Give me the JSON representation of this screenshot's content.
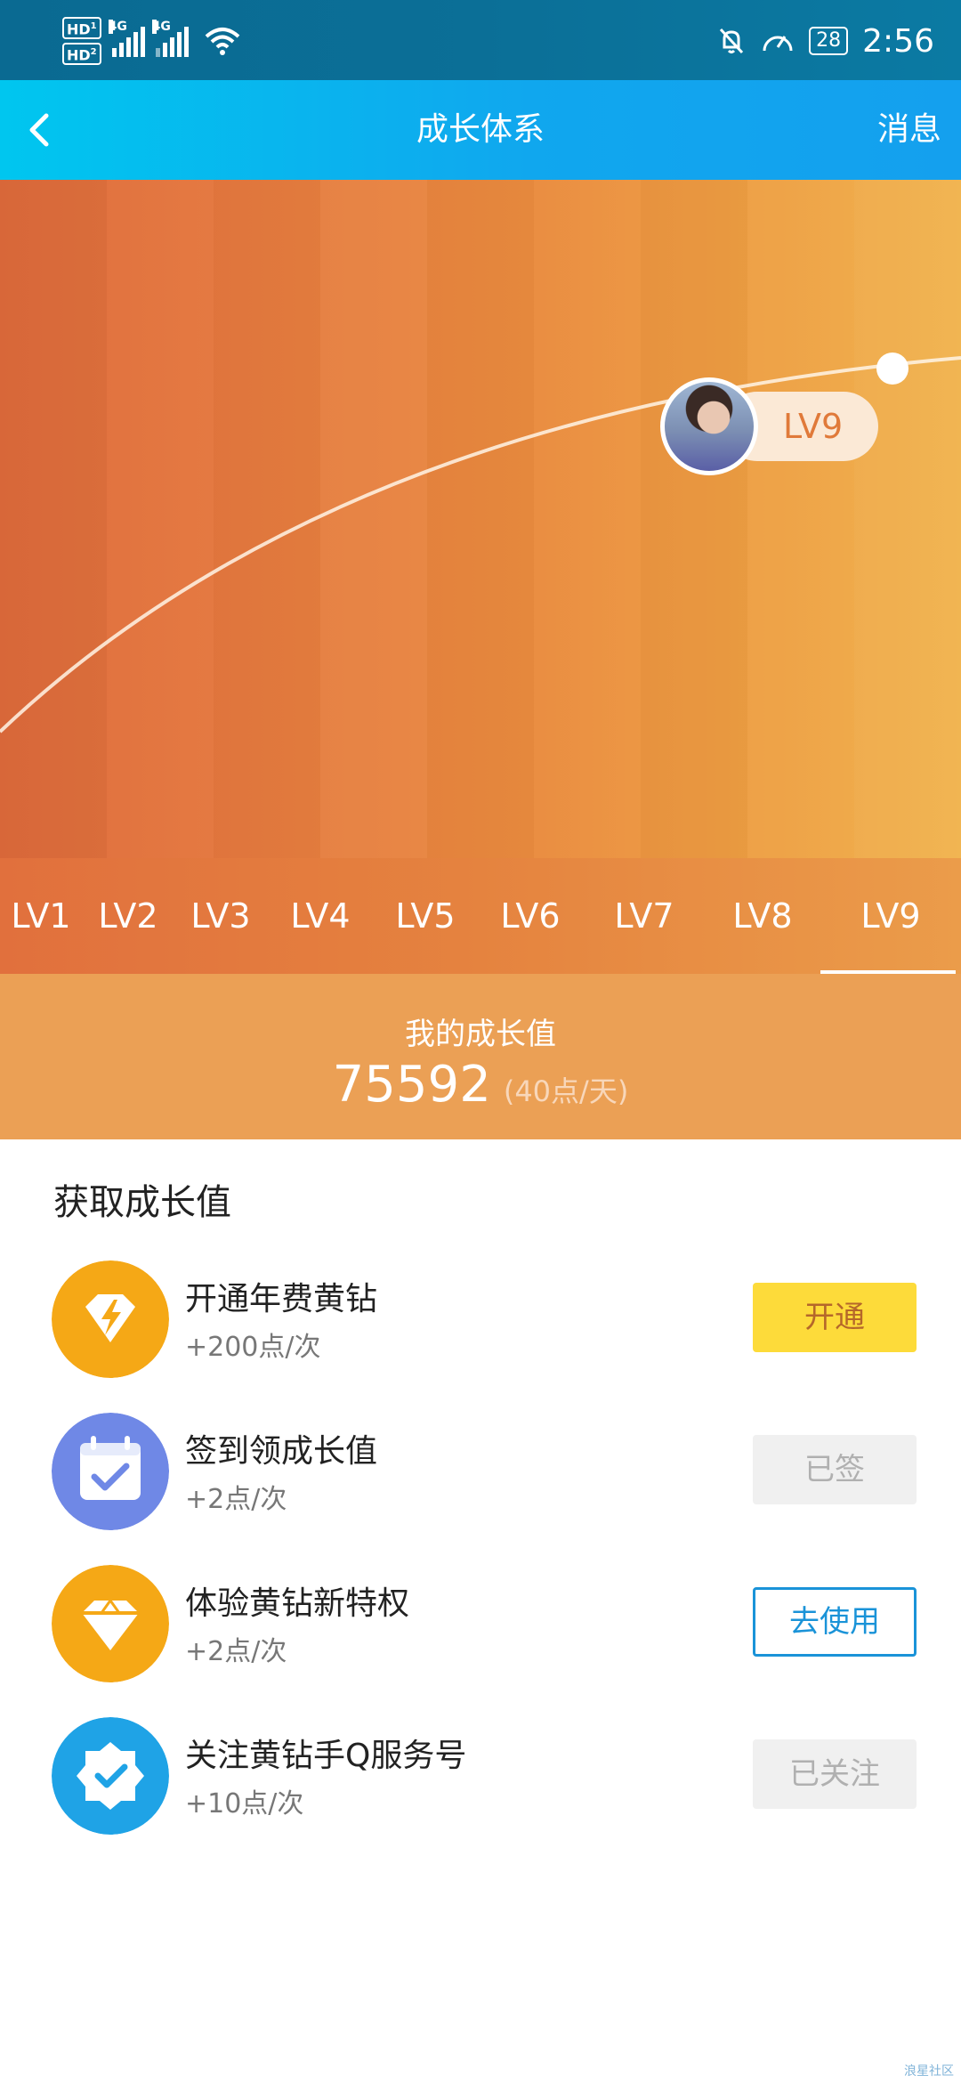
{
  "status_bar": {
    "hd1": "HD",
    "hd1_sub": "1",
    "hd2": "HD",
    "hd2_sub": "2",
    "net1": "4G",
    "net2": "4G",
    "battery": "28",
    "time": "2:56"
  },
  "header": {
    "title": "成长体系",
    "message": "消息"
  },
  "hero": {
    "current_level": "LV9"
  },
  "levels": [
    "LV1",
    "LV2",
    "LV3",
    "LV4",
    "LV5",
    "LV6",
    "LV7",
    "LV8",
    "LV9"
  ],
  "active_level_index": 8,
  "growth": {
    "label": "我的成长值",
    "value": "75592",
    "rate": "(40点/天)"
  },
  "earn": {
    "title": "获取成长值",
    "items": [
      {
        "name": "开通年费黄钻",
        "points": "+200点/次",
        "button": "开通",
        "icon": "lightning-diamond-icon",
        "color": "#f5a816"
      },
      {
        "name": "签到领成长值",
        "points": "+2点/次",
        "button": "已签",
        "icon": "calendar-check-icon",
        "color": "#6f88e6"
      },
      {
        "name": "体验黄钻新特权",
        "points": "+2点/次",
        "button": "去使用",
        "icon": "diamond-icon",
        "color": "#f5a816"
      },
      {
        "name": "关注黄钻手Q服务号",
        "points": "+10点/次",
        "button": "已关注",
        "icon": "badge-check-icon",
        "color": "#1fa3e6"
      }
    ]
  },
  "watermark": "浪星社区"
}
